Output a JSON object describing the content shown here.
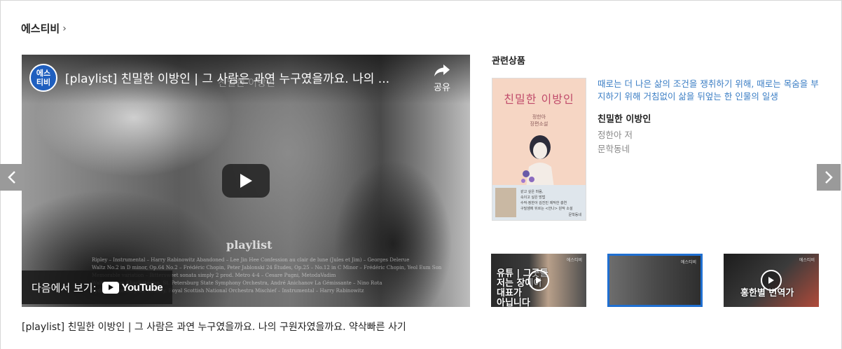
{
  "section": {
    "title": "에스티비",
    "chevron": "›"
  },
  "video": {
    "channel_logo": "에스\n티비",
    "title": "[playlist] 친밀한 이방인 | 그 사람은 과연 누구였을까요. 나의 ...",
    "watermark": "친밀한 이방인",
    "share_label": "공유",
    "playlist_word": "playlist",
    "credits": [
      "Ripley – Instrumental – Harry Rabinowitz   Abandoned – Lee Jin Hee   Confession au clair de lune (Jules et Jim) – Georges Delerue",
      "Waltz No.2 in D minor, Op.64 No.2 – Frédéric Chopin, Peter Jablonski   24 Études, Op.25 – No.12 in C Minor – Frédéric Chopin, Yeol Eum Son",
      "Memorable variation – Bittersweet sonata simply 2 prod. Metro 4-4 – Cesare Pugni, MetodaVadim",
      "Waltz – Aram Khachaturian, St. Petersburg State Symphony Orchestra, André Anichanov   La Gémissante – Nino Rota",
      "Lydia Carbonne, John Debney, Royal Scottish National Orchestra   Mischief – Instrumental – Harry Rabinowitz"
    ],
    "watch_on": "다음에서 보기:",
    "youtube": "YouTube",
    "caption": "[playlist] 친밀한 이방인 | 그 사람은 과연 누구였을까요. 나의 구원자였을까요. 약삭빠른 사기"
  },
  "related": {
    "heading": "관련상품",
    "cover": {
      "title": "친밀한 이방인",
      "author": "정한아\n장편소설",
      "lines": "같고 싶은 마음,\n속이고 싶은 방법\n수작·정한아 김진민 제작한 충연\n구밀샘에 뒤르는 <안나> 원작 소설",
      "publisher": "문학동네"
    },
    "description": "때로는 더 나은 삶의 조건을 쟁취하기 위해, 때로는 목숨을 부지하기 위해 거침없이 삶을 뒤엎는 한 인물의 일생",
    "book_title": "친밀한 이방인",
    "author": "정한아 저",
    "publisher": "문학동네"
  },
  "thumbnails": [
    {
      "text": "유튜 | 그곳들\n저는 장에이\n대표가\n아닙니다",
      "brand": "에스티비",
      "selected": false
    },
    {
      "text": "",
      "brand": "에스티비",
      "selected": true
    },
    {
      "text": "홍한별 번역가",
      "brand": "에스티비",
      "selected": false
    }
  ],
  "colors": {
    "accent_blue": "#1f6fd1",
    "description_blue": "#3a7dc4",
    "arrow_gray": "#9a9a9a"
  }
}
